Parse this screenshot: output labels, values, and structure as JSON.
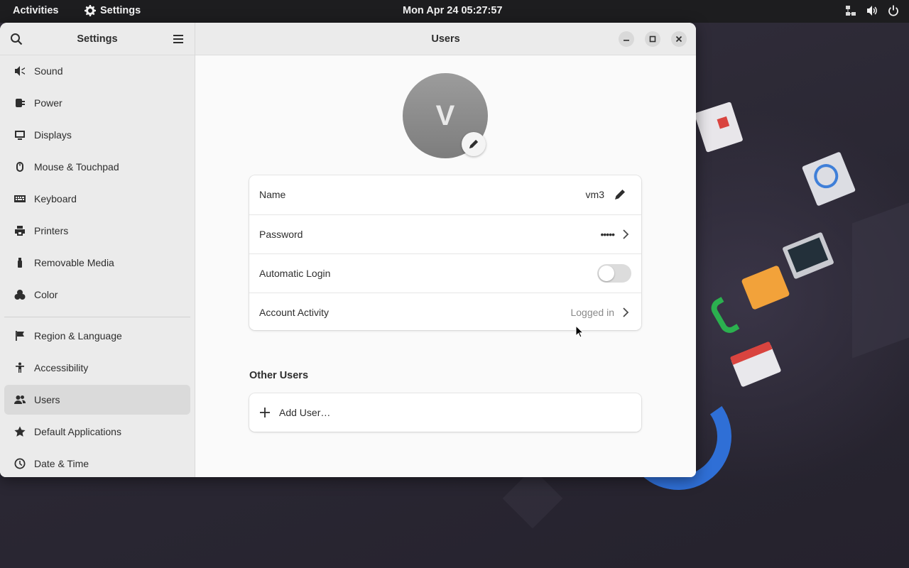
{
  "topbar": {
    "activities": "Activities",
    "app_name": "Settings",
    "clock": "Mon Apr 24  05:27:57",
    "tray_icons": [
      "network-icon",
      "volume-icon",
      "power-icon"
    ]
  },
  "sidebar": {
    "title": "Settings",
    "items": [
      {
        "label": "Sound",
        "icon": "speaker-icon"
      },
      {
        "label": "Power",
        "icon": "power-plug-icon"
      },
      {
        "label": "Displays",
        "icon": "display-icon"
      },
      {
        "label": "Mouse & Touchpad",
        "icon": "mouse-icon"
      },
      {
        "label": "Keyboard",
        "icon": "keyboard-icon"
      },
      {
        "label": "Printers",
        "icon": "printer-icon"
      },
      {
        "label": "Removable Media",
        "icon": "usb-icon"
      },
      {
        "label": "Color",
        "icon": "color-icon"
      },
      {
        "label": "Region & Language",
        "icon": "flag-icon"
      },
      {
        "label": "Accessibility",
        "icon": "accessibility-icon"
      },
      {
        "label": "Users",
        "icon": "users-icon",
        "active": true
      },
      {
        "label": "Default Applications",
        "icon": "star-icon"
      },
      {
        "label": "Date & Time",
        "icon": "clock-icon"
      }
    ]
  },
  "content": {
    "title": "Users",
    "avatar_initial": "V",
    "rows": {
      "name_label": "Name",
      "name_value": "vm3",
      "password_label": "Password",
      "password_value": "•••••",
      "autologin_label": "Automatic Login",
      "autologin_on": false,
      "activity_label": "Account Activity",
      "activity_value": "Logged in"
    },
    "other_users_title": "Other Users",
    "add_user_label": "Add User…"
  },
  "colors": {
    "topbar_bg": "#1d1d1f",
    "sidebar_bg": "#ebebeb",
    "content_bg": "#fafafa",
    "active_item_bg": "#dadada",
    "toggle_off": "#dcdcdc"
  }
}
